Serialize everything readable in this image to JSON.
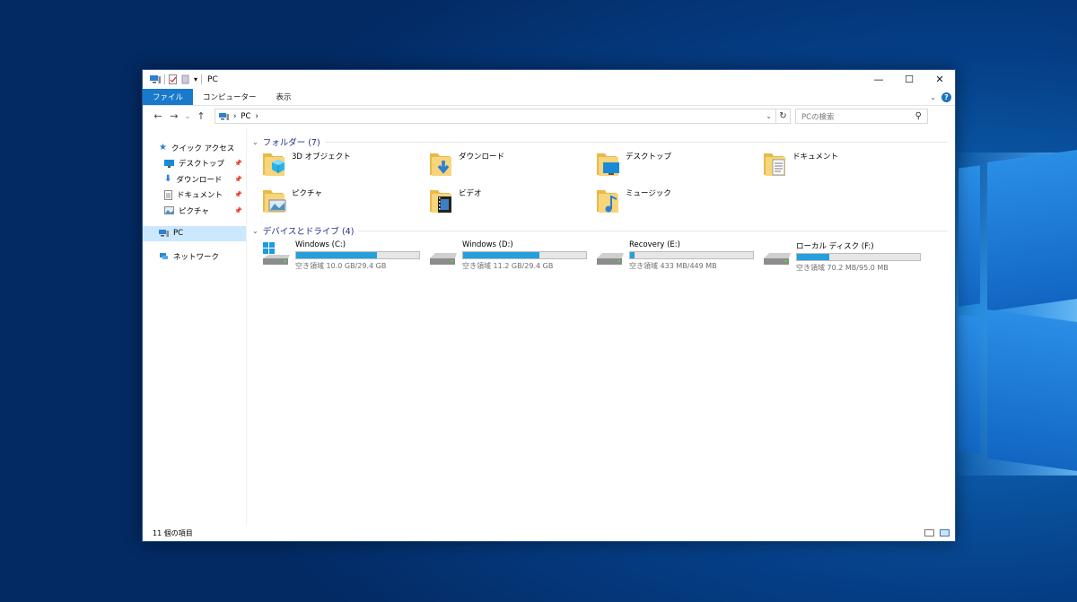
{
  "window": {
    "title": "PC",
    "controls": [
      "—",
      "☐",
      "✕"
    ]
  },
  "ribbon": {
    "tabs": [
      "ファイル",
      "コンピューター",
      "表示"
    ]
  },
  "address": {
    "path": [
      "PC"
    ],
    "search_placeholder": "PCの検索"
  },
  "nav": {
    "quick_access": "クイック アクセス",
    "pinned": [
      "デスクトップ",
      "ダウンロード",
      "ドキュメント",
      "ピクチャ"
    ],
    "pc": "PC",
    "network": "ネットワーク"
  },
  "folders": {
    "header": "フォルダー (7)",
    "items": [
      {
        "label": "3D オブジェクト",
        "icon": "3d-objects"
      },
      {
        "label": "ダウンロード",
        "icon": "downloads"
      },
      {
        "label": "デスクトップ",
        "icon": "desktop"
      },
      {
        "label": "ドキュメント",
        "icon": "documents"
      },
      {
        "label": "ピクチャ",
        "icon": "pictures"
      },
      {
        "label": "ビデオ",
        "icon": "videos"
      },
      {
        "label": "ミュージック",
        "icon": "music"
      }
    ]
  },
  "drives": {
    "header": "デバイスとドライブ (4)",
    "items": [
      {
        "label": "Windows (C:)",
        "free": "空き領域 10.0 GB/29.4 GB",
        "used_fraction": 0.66,
        "icon": "windows-drive"
      },
      {
        "label": "Windows (D:)",
        "free": "空き領域 11.2 GB/29.4 GB",
        "used_fraction": 0.62,
        "icon": "hdd"
      },
      {
        "label": "Recovery (E:)",
        "free": "空き領域 433 MB/449 MB",
        "used_fraction": 0.04,
        "icon": "hdd"
      },
      {
        "label": "ローカル ディスク (F:)",
        "free": "空き領域 70.2 MB/95.0 MB",
        "used_fraction": 0.26,
        "icon": "hdd"
      }
    ]
  },
  "status": {
    "count": "11 個の項目"
  }
}
